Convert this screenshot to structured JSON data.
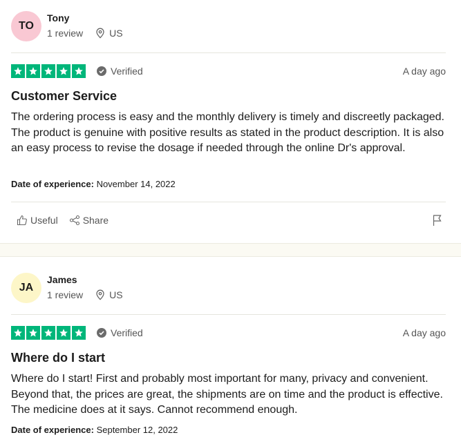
{
  "reviews": [
    {
      "initials": "TO",
      "avatar_color": "#f9c8d3",
      "name": "Tony",
      "review_count": "1 review",
      "country": "US",
      "verified": "Verified",
      "date": "A day ago",
      "rating": 5,
      "title": "Customer Service",
      "body": "The ordering process is easy and the monthly delivery is timely and discreetly packaged. The product is genuine with positive results as stated in the product description. It is also an easy process to revise the dosage if needed through the online Dr's approval.",
      "exp_label": "Date of experience:",
      "exp_date": "November 14, 2022",
      "useful_label": "Useful",
      "share_label": "Share"
    },
    {
      "initials": "JA",
      "avatar_color": "#fdf6c8",
      "name": "James",
      "review_count": "1 review",
      "country": "US",
      "verified": "Verified",
      "date": "A day ago",
      "rating": 5,
      "title": "Where do I start",
      "body": "Where do I start! First and probably most important for many, privacy and convenient. Beyond that, the prices are great, the shipments are on time and the product is effective. The medicine does at it says. Cannot recommend enough.",
      "exp_label": "Date of experience:",
      "exp_date": "September 12, 2022"
    }
  ],
  "colors": {
    "star_green": "#00b67a",
    "divider": "#e5e5dd"
  }
}
